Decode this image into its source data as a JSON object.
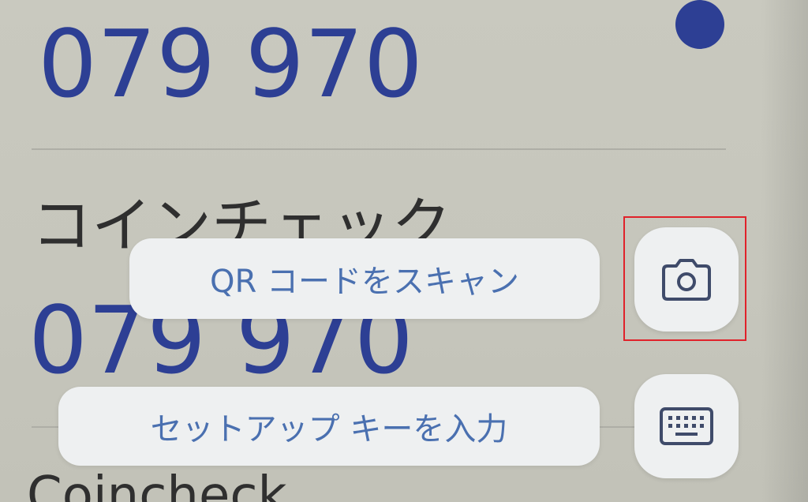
{
  "accounts": [
    {
      "code": "079 970"
    },
    {
      "issuer": "コインチェック",
      "code": "079 970"
    },
    {
      "label": "Coincheck"
    }
  ],
  "actions": {
    "scan_qr_label": "QR コードをスキャン",
    "setup_key_label": "セットアップ キーを入力"
  },
  "icons": {
    "scan_qr": "camera-icon",
    "setup_key": "keyboard-icon"
  },
  "colors": {
    "code_text": "#2d3f94",
    "action_text": "#4a70b0",
    "highlight": "#e0222a"
  }
}
